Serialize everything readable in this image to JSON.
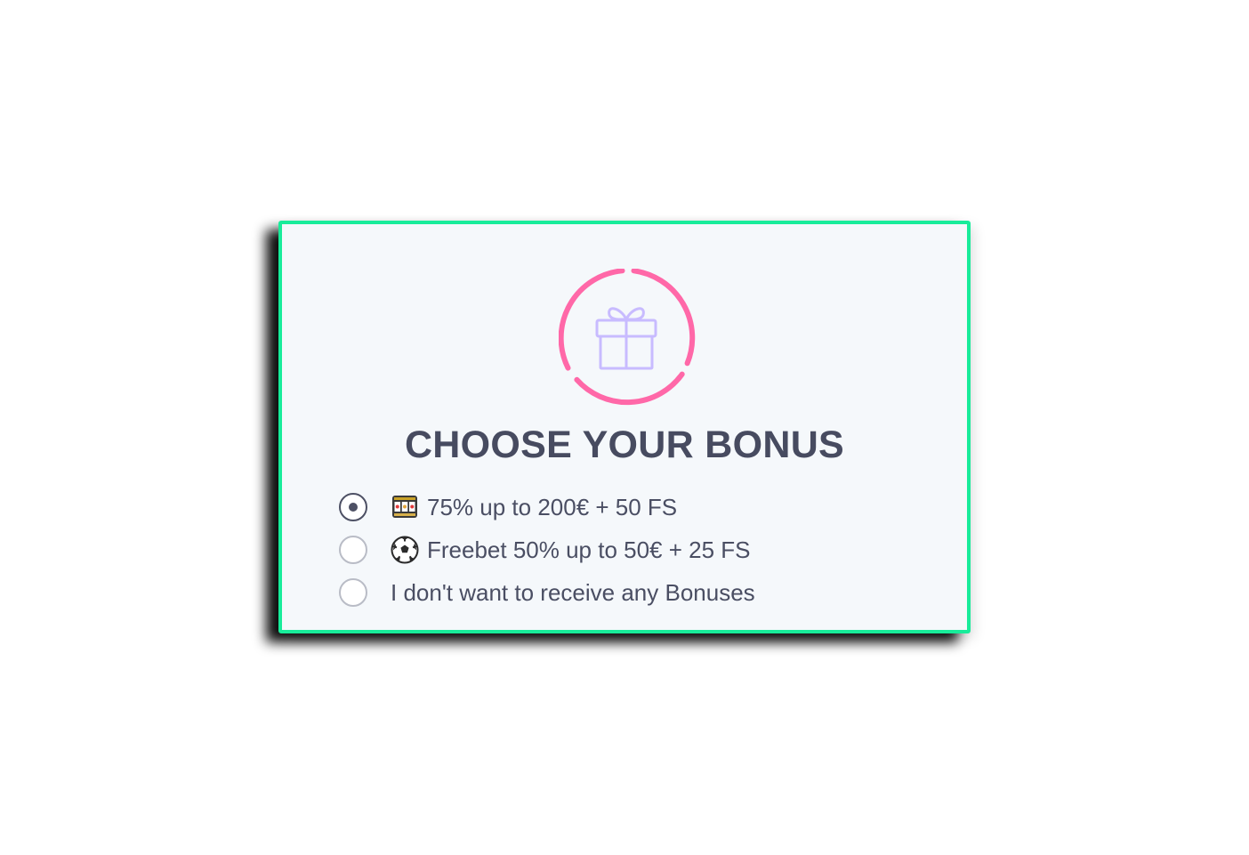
{
  "colors": {
    "card_border": "#18ec9a",
    "card_background": "#f5f8fb",
    "ring": "#ff68a8",
    "gift": "#c8bbff",
    "text": "#474b60"
  },
  "header": {
    "icon": "gift-icon",
    "title": "CHOOSE YOUR BONUS"
  },
  "options": [
    {
      "icon": "slot-machine-icon",
      "label": "75% up to 200€ + 50 FS",
      "selected": true
    },
    {
      "icon": "soccer-ball-icon",
      "label": "Freebet 50% up to 50€ + 25 FS",
      "selected": false
    },
    {
      "icon": "",
      "label": "I don't want to receive any Bonuses",
      "selected": false
    }
  ]
}
